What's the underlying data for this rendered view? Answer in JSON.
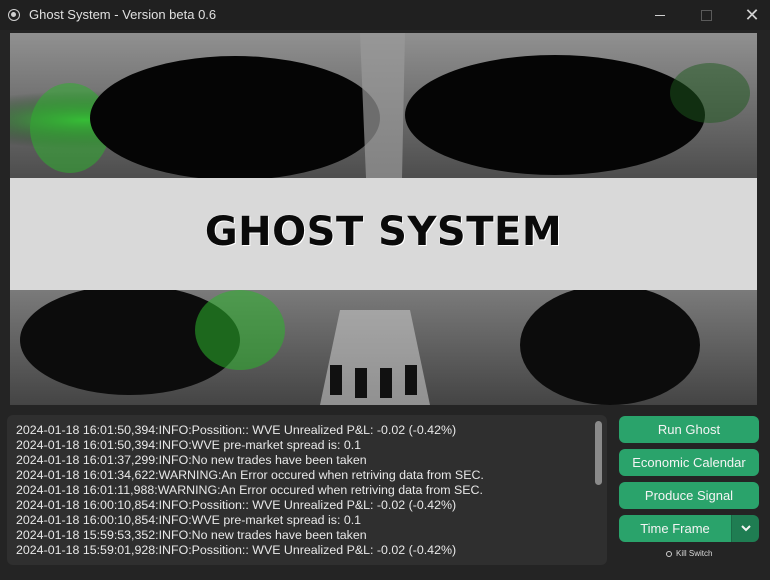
{
  "window": {
    "title": "Ghost System - Version beta 0.6",
    "controls": {
      "close": "✕"
    }
  },
  "banner": {
    "title": "GHOST SYSTEM"
  },
  "log": {
    "lines": [
      "2024-01-18 16:01:50,394:INFO:Possition:: WVE Unrealized P&L: -0.02 (-0.42%)",
      "2024-01-18 16:01:50,394:INFO:WVE pre-market spread is: 0.1",
      "2024-01-18 16:01:37,299:INFO:No new trades have been taken",
      "2024-01-18 16:01:34,622:WARNING:An Error occured when retriving data from SEC.",
      "2024-01-18 16:01:11,988:WARNING:An Error occured when retriving data from SEC.",
      "2024-01-18 16:00:10,854:INFO:Possition:: WVE Unrealized P&L: -0.02 (-0.42%)",
      "2024-01-18 16:00:10,854:INFO:WVE pre-market spread is: 0.1",
      "2024-01-18 15:59:53,352:INFO:No new trades have been taken",
      "2024-01-18 15:59:01,928:INFO:Possition:: WVE Unrealized P&L: -0.02 (-0.42%)"
    ]
  },
  "actions": {
    "run_ghost": "Run Ghost",
    "economic_calendar": "Economic Calendar",
    "produce_signal": "Produce Signal",
    "time_frame": "Time Frame",
    "time_frame_arrow": "⌄",
    "kill_switch": "Kill Switch"
  },
  "colors": {
    "accent": "#2aa36b",
    "accent_dark": "#1f7d52",
    "background": "#242424",
    "panel": "#2f2f2f"
  }
}
